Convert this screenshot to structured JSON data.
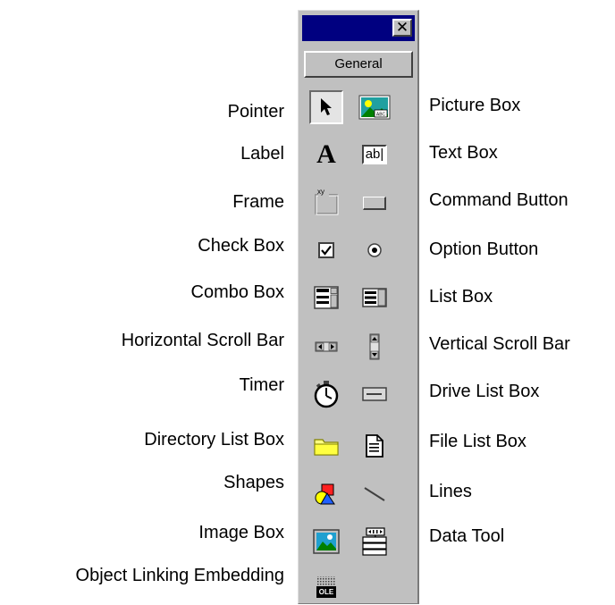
{
  "toolbox": {
    "close_glyph": "✕",
    "tab_label": "General"
  },
  "labels_left": {
    "pointer": "Pointer",
    "label": "Label",
    "frame": "Frame",
    "check_box": "Check Box",
    "combo_box": "Combo Box",
    "hscroll": "Horizontal Scroll Bar",
    "timer": "Timer",
    "dir_list": "Directory List Box",
    "shapes": "Shapes",
    "image_box": "Image Box",
    "ole": "Object Linking Embedding"
  },
  "labels_right": {
    "picture_box": "Picture Box",
    "text_box": "Text Box",
    "command_button": "Command Button",
    "option_button": "Option Button",
    "list_box": "List Box",
    "vscroll": "Vertical Scroll Bar",
    "drive_list": "Drive List Box",
    "file_list": "File List Box",
    "lines": "Lines",
    "data_tool": "Data Tool"
  },
  "icons": {
    "label_glyph": "A",
    "textbox_glyph": "ab|",
    "frame_glyph": "xy",
    "ole_glyph": "OLE"
  },
  "colors": {
    "titlebar": "#000080",
    "toolbox_face": "#c0c0c0"
  }
}
